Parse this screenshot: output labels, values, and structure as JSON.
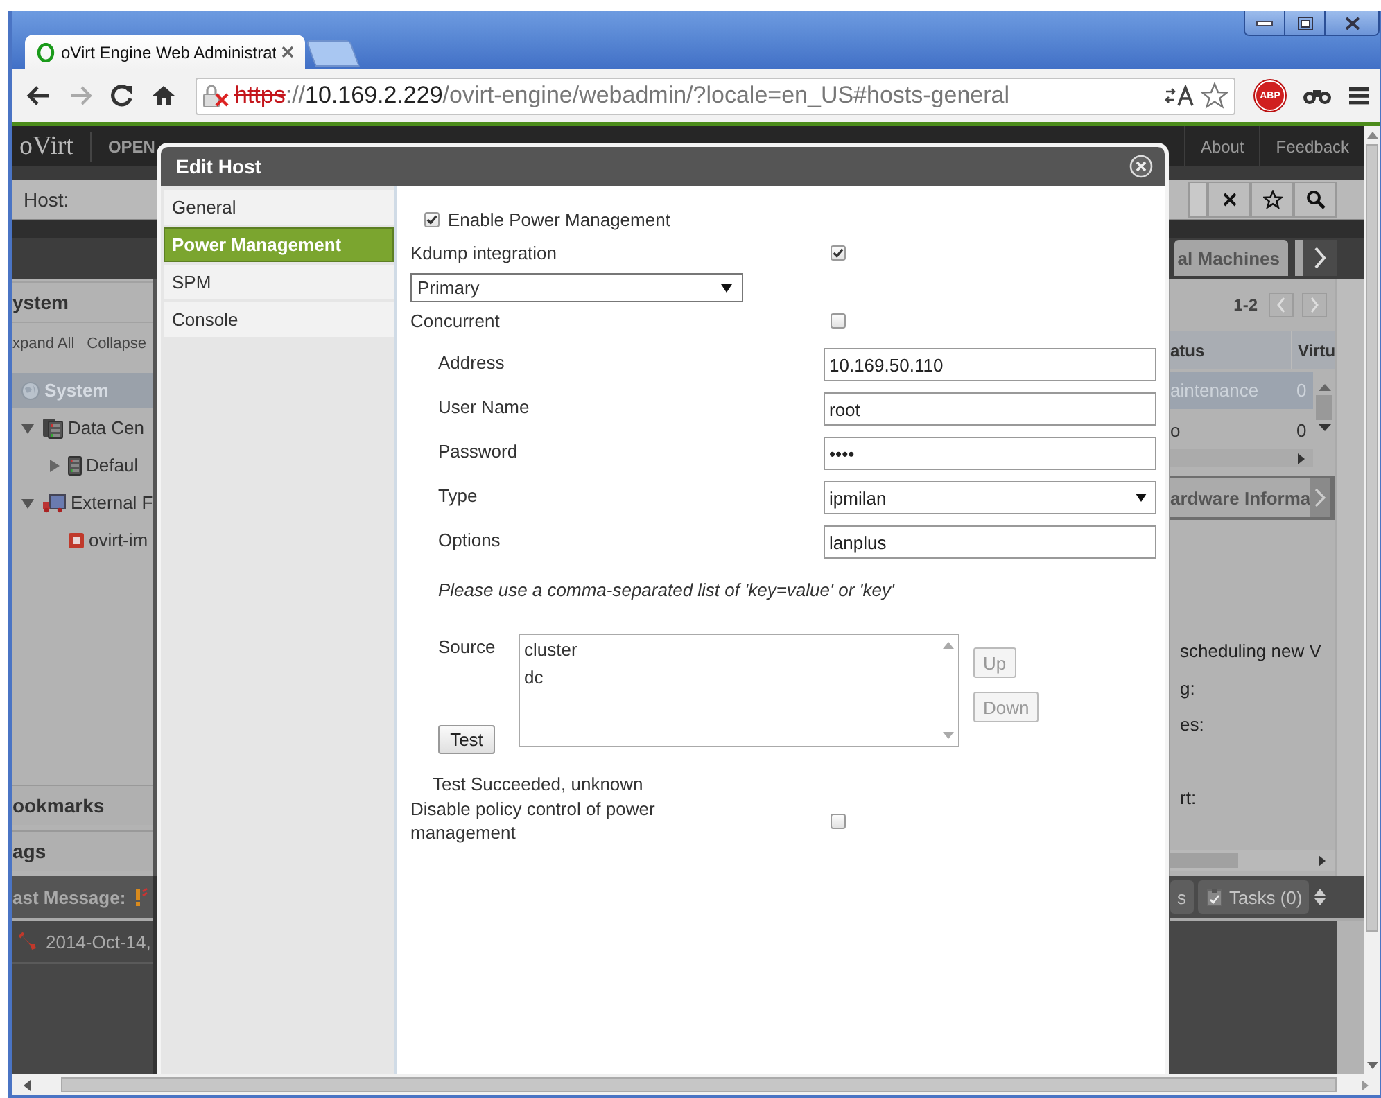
{
  "browser": {
    "tab_title": "oVirt Engine Web Administrat",
    "address": [
      {
        "text": "https",
        "kind": "insecure"
      },
      {
        "text": "://",
        "kind": "dim"
      },
      {
        "text": "10.169.2.229",
        "kind": "host"
      },
      {
        "text": "/ovirt-engine/webadmin/?locale=en_US#hosts-general",
        "kind": "dim"
      }
    ],
    "extension_badge": "ABP"
  },
  "app": {
    "logo": "oVirt",
    "nav_label": "OPEN",
    "header_links": [
      "About",
      "Feedback"
    ],
    "search_label": "Host:",
    "main_tab": "al Machines"
  },
  "left_panel": {
    "title": "ystem",
    "actions": [
      "xpand All",
      "Collapse"
    ],
    "tree": [
      {
        "label": "System",
        "kind": "system",
        "selected": true,
        "children": [
          {
            "label": "Data Cen",
            "kind": "datacenters",
            "selected": false,
            "expanded": true,
            "children": [
              {
                "label": "Defaul",
                "kind": "datacenter",
                "selected": false,
                "expanded": false
              }
            ]
          },
          {
            "label": "External F",
            "kind": "providers",
            "selected": false,
            "expanded": true,
            "children": [
              {
                "label": "ovirt-im",
                "kind": "provider",
                "selected": false
              }
            ]
          }
        ]
      }
    ],
    "sections": [
      "ookmarks",
      "ags"
    ]
  },
  "right_panel": {
    "pager": "1-2",
    "columns": [
      "atus",
      "Virtu"
    ],
    "rows": [
      {
        "cells": [
          "aintenance",
          "0"
        ],
        "selected": true
      },
      {
        "cells": [
          "o",
          "0"
        ],
        "selected": false
      }
    ],
    "subtab": "ardware Informa",
    "details": [
      "scheduling new V",
      "g:",
      "es:",
      "rt:"
    ]
  },
  "footer": {
    "last_message_label": "ast Message:",
    "event": "2014-Oct-14,",
    "tabs": [
      "s",
      "Tasks (0)"
    ]
  },
  "dialog": {
    "title": "Edit Host",
    "nav": [
      {
        "label": "General",
        "selected": false
      },
      {
        "label": "Power Management",
        "selected": true
      },
      {
        "label": "SPM",
        "selected": false
      },
      {
        "label": "Console",
        "selected": false
      }
    ],
    "enable_pm": {
      "label": "Enable Power Management",
      "checked": true
    },
    "kdump": {
      "label": "Kdump integration",
      "checked": true
    },
    "agent_order": {
      "value": "Primary"
    },
    "concurrent": {
      "label": "Concurrent",
      "checked": false
    },
    "fields": [
      {
        "label": "Address",
        "kind": "text",
        "value": "10.169.50.110"
      },
      {
        "label": "User Name",
        "kind": "text",
        "value": "root"
      },
      {
        "label": "Password",
        "kind": "password",
        "value": "••••"
      },
      {
        "label": "Type",
        "kind": "select",
        "value": "ipmilan"
      },
      {
        "label": "Options",
        "kind": "text",
        "value": "lanplus"
      }
    ],
    "options_hint": "Please use a comma-separated list of 'key=value' or 'key'",
    "source": {
      "label": "Source",
      "items": [
        "cluster",
        "dc"
      ],
      "buttons": [
        {
          "label": "Up",
          "disabled": true
        },
        {
          "label": "Down",
          "disabled": true
        }
      ]
    },
    "test_button": "Test",
    "test_result": "Test Succeeded, unknown",
    "disable_policy": {
      "label": "Disable policy control of power management",
      "checked": false
    }
  }
}
